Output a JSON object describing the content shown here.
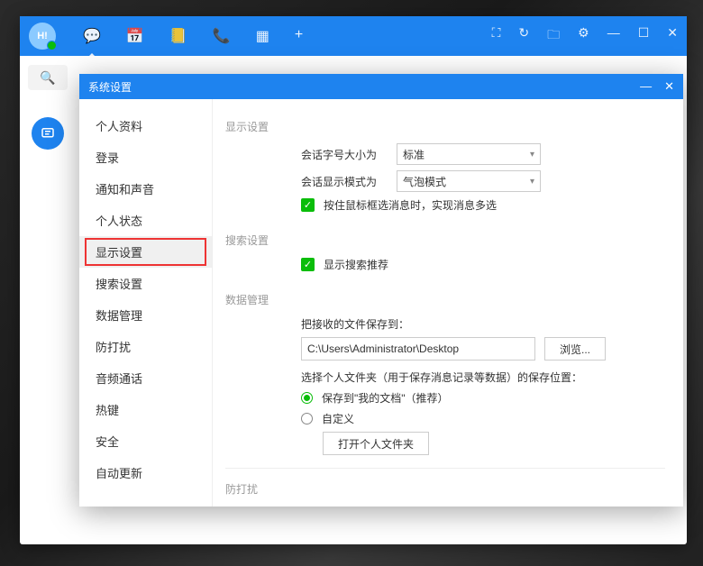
{
  "titlebar": {
    "avatar_text": "H!",
    "icons": [
      "chat",
      "calendar",
      "notes",
      "phone",
      "apps",
      "plus"
    ],
    "right_icons": [
      "capture",
      "history",
      "folder",
      "gear",
      "min",
      "max",
      "close"
    ]
  },
  "dialog": {
    "title": "系统设置",
    "nav": [
      "个人资料",
      "登录",
      "通知和声音",
      "个人状态",
      "显示设置",
      "搜索设置",
      "数据管理",
      "防打扰",
      "音频通话",
      "热键",
      "安全",
      "自动更新"
    ],
    "nav_selected_index": 4,
    "sections": {
      "display": {
        "label": "显示设置",
        "font_label": "会话字号大小为",
        "font_value": "标准",
        "mode_label": "会话显示模式为",
        "mode_value": "气泡模式",
        "multiselect_label": "按住鼠标框选消息时，实现消息多选"
      },
      "search": {
        "label": "搜索设置",
        "recommend_label": "显示搜索推荐"
      },
      "data": {
        "label": "数据管理",
        "save_to_label": "把接收的文件保存到：",
        "path_value": "C:\\Users\\Administrator\\Desktop",
        "browse_btn": "浏览...",
        "folder_hint": "选择个人文件夹（用于保存消息记录等数据）的保存位置：",
        "radio_docs": "保存到\"我的文档\"（推荐）",
        "radio_custom": "自定义",
        "open_folder_btn": "打开个人文件夹"
      },
      "dnd": {
        "label": "防打扰"
      }
    }
  }
}
